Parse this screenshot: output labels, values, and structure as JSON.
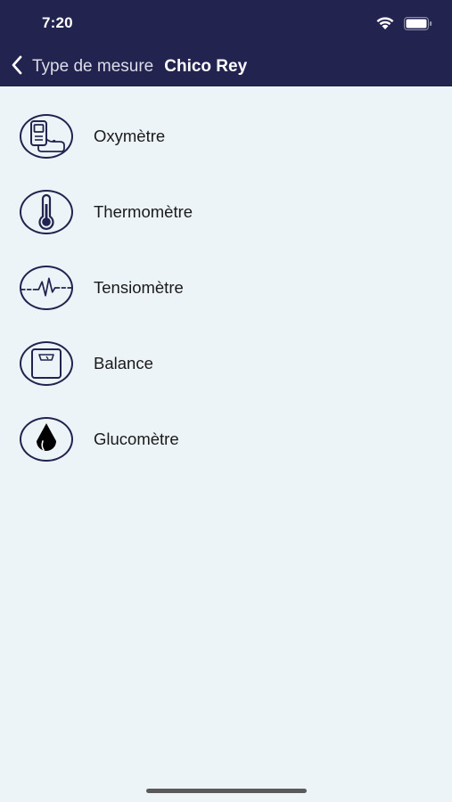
{
  "status_bar": {
    "time": "7:20",
    "icons": [
      "wifi-icon",
      "battery-icon"
    ]
  },
  "nav": {
    "back_label": "Type de mesure",
    "title": "Chico Rey",
    "back_icon": "chevron-left-icon"
  },
  "items": [
    {
      "label": "Oxymètre",
      "icon": "oximeter-icon"
    },
    {
      "label": "Thermomètre",
      "icon": "thermometer-icon"
    },
    {
      "label": "Tensiomètre",
      "icon": "heartbeat-icon"
    },
    {
      "label": "Balance",
      "icon": "scale-icon"
    },
    {
      "label": "Glucomètre",
      "icon": "blood-drop-icon"
    }
  ],
  "colors": {
    "header_bg": "#23234f",
    "page_bg": "#edf4f7",
    "icon_stroke": "#23234f",
    "text": "#1a1a1a"
  }
}
